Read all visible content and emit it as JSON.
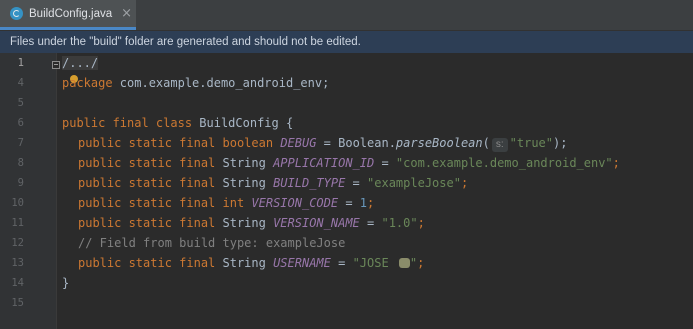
{
  "tab": {
    "filename": "BuildConfig.java",
    "close": "×"
  },
  "banner": {
    "text": "Files under the \"build\" folder are generated and should not be edited."
  },
  "gutter": {
    "line_numbers": [
      "1",
      "4",
      "5",
      "6",
      "7",
      "8",
      "9",
      "10",
      "11",
      "12",
      "13",
      "14",
      "15"
    ]
  },
  "code": {
    "folded_import": "/.../",
    "package_kw": "package",
    "package_name": " com.example.demo_android_env;",
    "class_decl_kw": "public final class",
    "class_name": " BuildConfig {",
    "mods_bool": "public static final boolean",
    "debug_name": "DEBUG",
    "eq": " = ",
    "boolean_parse": "Boolean.",
    "parse_method": "parseBoolean",
    "paren_open": "(",
    "hint_s": "s:",
    "debug_value": "\"true\"",
    "paren_close": ");",
    "mods_string": "public static final",
    "type_string": " String ",
    "app_id_name": "APPLICATION_ID",
    "app_id_value": "\"com.example.demo_android_env\"",
    "semicolon": ";",
    "build_type_name": "BUILD_TYPE",
    "build_type_value": "\"exampleJose\"",
    "mods_int": "public static final int",
    "version_code_name": "VERSION_CODE",
    "version_code_value": "1",
    "version_name_name": "VERSION_NAME",
    "version_name_value": "\"1.0\"",
    "comment": "// Field from build type: exampleJose",
    "username_name": "USERNAME",
    "username_value_start": "\"JOSE ",
    "username_value_end": "\"",
    "close_brace": "}"
  },
  "colors": {
    "keyword": "#cc7832",
    "string": "#6a8759",
    "constant": "#9876aa",
    "number": "#6897bb",
    "comment": "#808080",
    "banner_bg": "#2d3e55"
  }
}
